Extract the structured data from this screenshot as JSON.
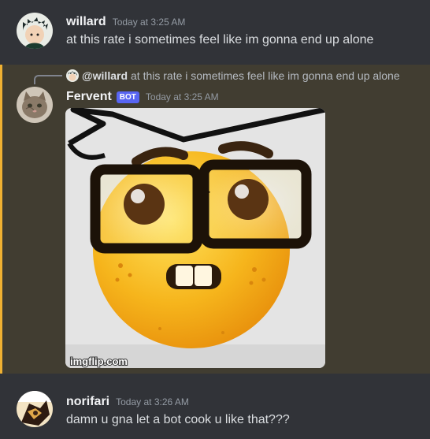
{
  "messages": [
    {
      "author": "willard",
      "timestamp": "Today at 3:25 AM",
      "content": "at this rate i sometimes feel like im gonna end up alone"
    },
    {
      "reply": {
        "author": "@willard",
        "content": "at this rate i sometimes feel like im gonna end up alone"
      },
      "author": "Fervent",
      "badge": "BOT",
      "timestamp": "Today at 3:25 AM",
      "attachment": {
        "icon": "nerd-emoji-meme",
        "watermark": "imgflip.com"
      }
    },
    {
      "author": "norifari",
      "timestamp": "Today at 3:26 AM",
      "content": "damn u gna let a bot cook u like that???"
    }
  ],
  "colors": {
    "background": "#313338",
    "highlight": "#413d31",
    "highlight_bar": "#f0b132",
    "bot_badge": "#5865f2"
  }
}
